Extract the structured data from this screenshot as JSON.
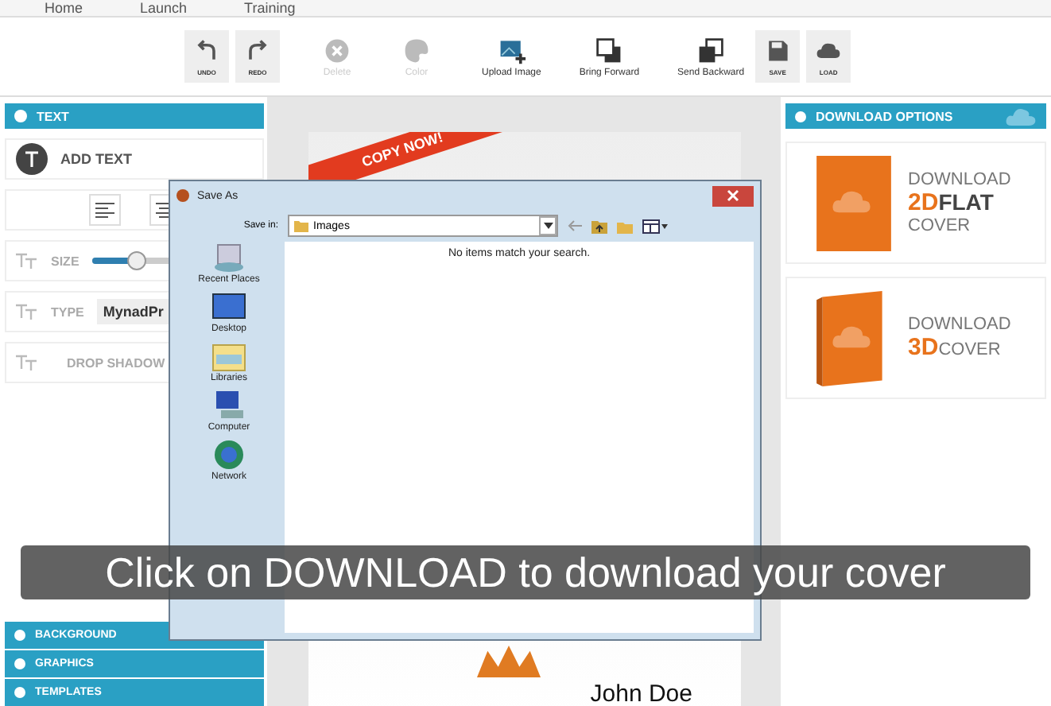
{
  "nav": [
    "Home",
    "Launch",
    "Training"
  ],
  "toolbar": [
    {
      "kind": "undo",
      "label": "UNDO",
      "disabled": false
    },
    {
      "kind": "redo",
      "label": "REDO",
      "disabled": false
    },
    {
      "kind": "delete",
      "label": "Delete",
      "disabled": true
    },
    {
      "kind": "color",
      "label": "Color",
      "disabled": true
    },
    {
      "kind": "upload",
      "label": "Upload Image",
      "disabled": false
    },
    {
      "kind": "forward",
      "label": "Bring Forward",
      "disabled": false
    },
    {
      "kind": "backward",
      "label": "Send Backward",
      "disabled": false
    },
    {
      "kind": "save",
      "label": "SAVE",
      "disabled": false
    },
    {
      "kind": "load",
      "label": "LOAD",
      "disabled": false
    }
  ],
  "left_panel": {
    "header": "TEXT",
    "add_text": "ADD TEXT",
    "size_label": "SIZE",
    "size": {
      "level": 0.35
    },
    "type_label": "TYPE",
    "type_value": "MynadPr",
    "drop_shadow": "DROP SHADOW",
    "sections": [
      "BACKGROUND",
      "GRAPHICS",
      "TEMPLATES"
    ]
  },
  "canvas": {
    "ribbon": "COPY NOW!",
    "author": "John Doe"
  },
  "right_panel": {
    "header": "DOWNLOAD OPTIONS",
    "options": [
      {
        "kind": "flat",
        "line1": "DOWNLOAD",
        "accent": "2D",
        "accent_rest": "FLAT",
        "line3": "COVER"
      },
      {
        "kind": "box",
        "line1": "DOWNLOAD",
        "accent": "3D",
        "accent_rest": "COVER"
      }
    ]
  },
  "dialog": {
    "title": "Save As",
    "save_in_label": "Save in:",
    "folder": "Images",
    "message": "No items match your search.",
    "places": [
      {
        "kind": "recent",
        "label": "Recent Places"
      },
      {
        "kind": "desktop",
        "label": "Desktop"
      },
      {
        "kind": "libraries",
        "label": "Libraries"
      },
      {
        "kind": "computer",
        "label": "Computer"
      },
      {
        "kind": "network",
        "label": "Network"
      }
    ]
  },
  "caption": "Click on DOWNLOAD to download your cover"
}
